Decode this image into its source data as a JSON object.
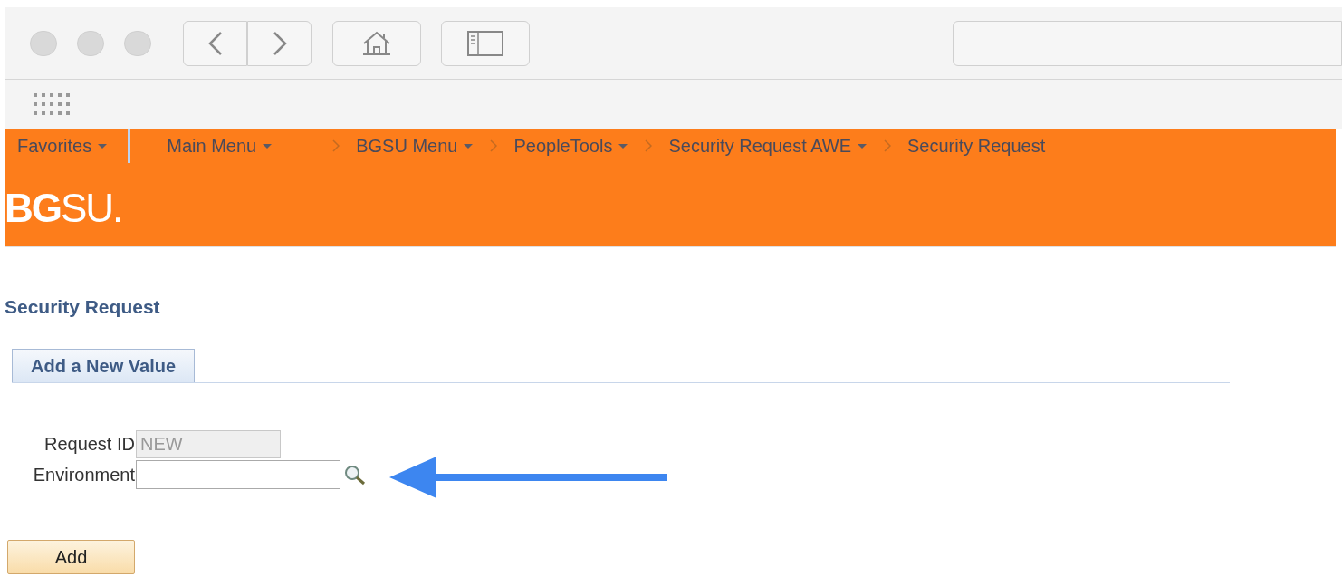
{
  "menu_bar": {
    "favorites": {
      "label": "Favorites",
      "dropdown": true
    },
    "breadcrumbs": [
      {
        "label": "Main Menu",
        "dropdown": true
      },
      {
        "label": "BGSU Menu",
        "dropdown": true
      },
      {
        "label": "PeopleTools",
        "dropdown": true
      },
      {
        "label": "Security Request AWE",
        "dropdown": true
      },
      {
        "label": "Security Request",
        "dropdown": false
      }
    ]
  },
  "logo": "**BG**SU.",
  "page_title": "Security Request",
  "tabs": [
    {
      "label": "Add a New Value",
      "selected": true
    }
  ],
  "fields": [
    {
      "label": "Request ID",
      "value": "NEW",
      "disabled": true,
      "lookup": false
    },
    {
      "label": "Environment",
      "disabled": false,
      "lookup": true
    }
  ],
  "add_button": "Add"
}
